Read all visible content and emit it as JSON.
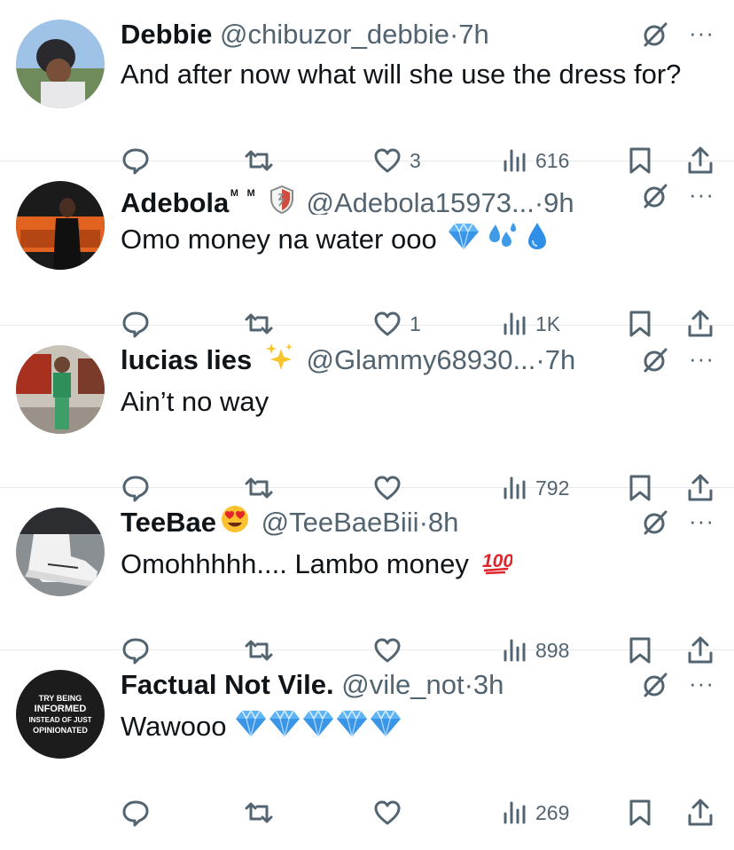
{
  "tweets": [
    {
      "name": "Debbie",
      "handle": "@chibuzor_debbie",
      "dot": "·",
      "time": "7h",
      "text": "And after now what will she use the dress for?",
      "likes": "3",
      "views": "616"
    },
    {
      "name": "Adebola",
      "name_sup": "ᴹ ᴹ",
      "handle": "@Adebola15973...",
      "dot": "·",
      "time": "9h",
      "text": "Omo money na water ooo",
      "likes": "1",
      "views": "1K"
    },
    {
      "name": "lucias lies",
      "handle": "@Glammy68930...",
      "dot": "·",
      "time": "7h",
      "text": "Ain’t no way",
      "likes": "",
      "views": "792"
    },
    {
      "name": "TeeBae",
      "handle": "@TeeBaeBiii",
      "dot": "·",
      "time": "8h",
      "text": "Omohhhhh.... Lambo money",
      "likes": "",
      "views": "898"
    },
    {
      "name": "Factual Not Vile.",
      "handle": "@vile_not",
      "dot": "·",
      "time": "3h",
      "text": "Wawooo",
      "likes": "",
      "views": "269",
      "avatar_text": [
        "TRY BEING",
        "INFORMED",
        "INSTEAD OF JUST",
        "OPINIONATED"
      ]
    }
  ],
  "icons": [
    "reply-icon",
    "retweet-icon",
    "like-icon",
    "views-icon",
    "bookmark-icon",
    "share-icon",
    "grok-icon",
    "more-icon"
  ],
  "colors": {
    "text": "#0f1419",
    "secondary": "#536471",
    "divider": "#e7e9ea",
    "diamond": "#4aa3f0",
    "droplet": "#2f8fe6",
    "hundred": "#e0242b"
  }
}
